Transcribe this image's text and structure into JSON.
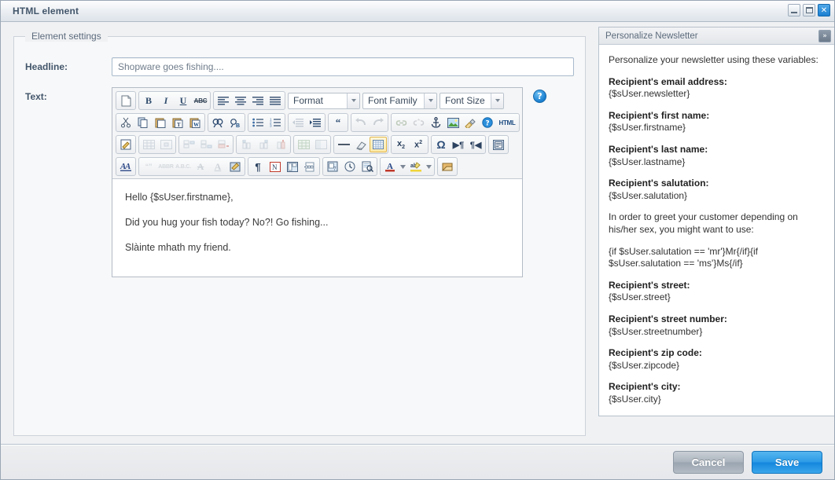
{
  "window": {
    "title": "HTML element",
    "controls": [
      {
        "name": "minimize-button",
        "label": ""
      },
      {
        "name": "maximize-button",
        "label": ""
      },
      {
        "name": "close-button",
        "label": "✕"
      }
    ]
  },
  "form": {
    "legend": "Element settings",
    "headline_label": "Headline:",
    "headline_value": "Shopware goes fishing....",
    "headline_placeholder": "Shopware goes fishing....",
    "text_label": "Text:",
    "help_glyph": "?"
  },
  "editor": {
    "dropdowns": {
      "format": "Format",
      "font_family": "Font Family",
      "font_size": "Font Size"
    },
    "toolbar_rows": [
      [
        "new-document-icon",
        "bold-icon",
        "italic-icon",
        "underline-icon",
        "strikethrough-icon",
        "align-left-icon",
        "align-center-icon",
        "align-right-icon",
        "align-justify-icon"
      ],
      [
        "cut-icon",
        "copy-icon",
        "paste-icon",
        "paste-text-icon",
        "paste-word-icon",
        "find-icon",
        "find-replace-icon",
        "bullet-list-icon",
        "numbered-list-icon",
        "outdent-icon",
        "indent-icon",
        "blockquote-icon",
        "undo-icon",
        "redo-icon",
        "link-icon",
        "unlink-icon",
        "anchor-icon",
        "image-icon",
        "cleanup-icon",
        "help-icon",
        "html-source-icon"
      ],
      [
        "edit-css-icon",
        "insert-table-icon",
        "table-properties-icon",
        "row-properties-icon",
        "cell-properties-icon",
        "row-before-icon",
        "row-after-icon",
        "delete-row-icon",
        "col-before-icon",
        "col-after-icon",
        "delete-col-icon",
        "split-cells-icon",
        "merge-cells-icon",
        "horizontal-rule-icon",
        "remove-format-icon",
        "visual-aid-icon",
        "subscript-icon",
        "superscript-icon",
        "special-char-icon",
        "ltr-icon",
        "rtl-icon",
        "fullscreen-icon"
      ],
      [
        "styles-icon",
        "citation-icon",
        "abbreviation-icon",
        "acronym-icon",
        "delete-text-icon",
        "insert-text-icon",
        "attributes-icon",
        "show-blocks-icon",
        "nonbreaking-icon",
        "template-icon",
        "page-break-icon",
        "insert-date-icon",
        "insert-time-icon",
        "preview-icon",
        "forecolor-icon",
        "backcolor-icon",
        "media-icon"
      ]
    ],
    "html_button_label": "HTML",
    "content": [
      "Hello {$sUser.firstname},",
      "Did you hug your fish today? No?! Go fishing...",
      "Slàinte mhath my friend."
    ]
  },
  "side_panel": {
    "title": "Personalize Newsletter",
    "collapse_glyph": "»",
    "intro": "Personalize your newsletter using these variables:",
    "variables": [
      {
        "title": "Recipient's email address:",
        "value": "{$sUser.newsletter}"
      },
      {
        "title": "Recipient's first name:",
        "value": "{$sUser.firstname}"
      },
      {
        "title": "Recipient's last name:",
        "value": "{$sUser.lastname}"
      },
      {
        "title": "Recipient's salutation:",
        "value": "{$sUser.salutation}"
      }
    ],
    "note": "In order to greet your customer depending on his/her sex, you might want to use:",
    "code": "{if $sUser.salutation == 'mr'}Mr{/if}{if $sUser.salutation == 'ms'}Ms{/if}",
    "variables2": [
      {
        "title": "Recipient's street:",
        "value": "{$sUser.street}"
      },
      {
        "title": "Recipient's street number:",
        "value": "{$sUser.streetnumber}"
      },
      {
        "title": "Recipient's zip code:",
        "value": "{$sUser.zipcode}"
      },
      {
        "title": "Recipient's city:",
        "value": "{$sUser.city}"
      }
    ]
  },
  "footer": {
    "cancel_label": "Cancel",
    "save_label": "Save"
  },
  "colors": {
    "accent": "#1386dd",
    "title_text": "#43566b",
    "panel_bg": "#f0f1f3"
  }
}
